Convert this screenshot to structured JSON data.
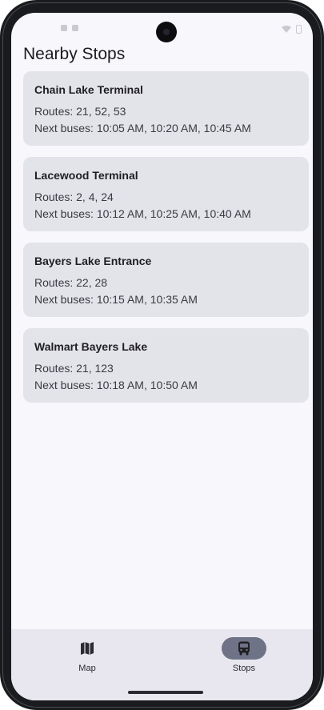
{
  "page": {
    "title": "Nearby Stops"
  },
  "stops": [
    {
      "name": "Chain Lake Terminal",
      "routes": "Routes: 21, 52, 53",
      "next_buses": "Next buses: 10:05 AM, 10:20 AM, 10:45 AM"
    },
    {
      "name": "Lacewood Terminal",
      "routes": "Routes: 2, 4, 24",
      "next_buses": "Next buses: 10:12 AM, 10:25 AM, 10:40 AM"
    },
    {
      "name": "Bayers Lake Entrance",
      "routes": "Routes: 22, 28",
      "next_buses": "Next buses: 10:15 AM, 10:35 AM"
    },
    {
      "name": "Walmart Bayers Lake",
      "routes": "Routes: 21, 123",
      "next_buses": "Next buses: 10:18 AM, 10:50 AM"
    }
  ],
  "nav": {
    "items": [
      {
        "label": "Map",
        "icon": "map-icon",
        "selected": false
      },
      {
        "label": "Stops",
        "icon": "bus-icon",
        "selected": true
      }
    ]
  },
  "colors": {
    "background": "#f8f7fc",
    "card": "#e3e3ea",
    "nav_background": "#e8e7ef",
    "nav_active_pill": "#6f7388"
  }
}
